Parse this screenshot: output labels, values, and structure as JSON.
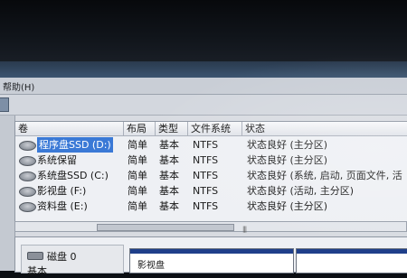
{
  "menubar": {
    "help_label": "帮助(H)"
  },
  "volume_list": {
    "columns": [
      "卷",
      "布局",
      "类型",
      "文件系统",
      "状态"
    ],
    "rows": [
      {
        "name": "程序盘SSD (D:)",
        "layout": "简单",
        "type": "基本",
        "fs": "NTFS",
        "status": "状态良好 (主分区)",
        "selected": true
      },
      {
        "name": "系统保留",
        "layout": "简单",
        "type": "基本",
        "fs": "NTFS",
        "status": "状态良好 (主分区)",
        "selected": false
      },
      {
        "name": "系统盘SSD (C:)",
        "layout": "简单",
        "type": "基本",
        "fs": "NTFS",
        "status": "状态良好 (系统, 启动, 页面文件, 活",
        "selected": false
      },
      {
        "name": "影视盘  (F:)",
        "layout": "简单",
        "type": "基本",
        "fs": "NTFS",
        "status": "状态良好 (活动, 主分区)",
        "selected": false
      },
      {
        "name": "资料盘 (E:)",
        "layout": "简单",
        "type": "基本",
        "fs": "NTFS",
        "status": "状态良好 (主分区)",
        "selected": false
      }
    ]
  },
  "scrollbar": {
    "grip": "|||"
  },
  "disk_pane": {
    "disk_label": "磁盘 0",
    "disk_type": "基本",
    "partition_label": "影视盘"
  },
  "icons": {
    "volume": "disk-drive-icon",
    "disk": "hard-disk-icon"
  }
}
